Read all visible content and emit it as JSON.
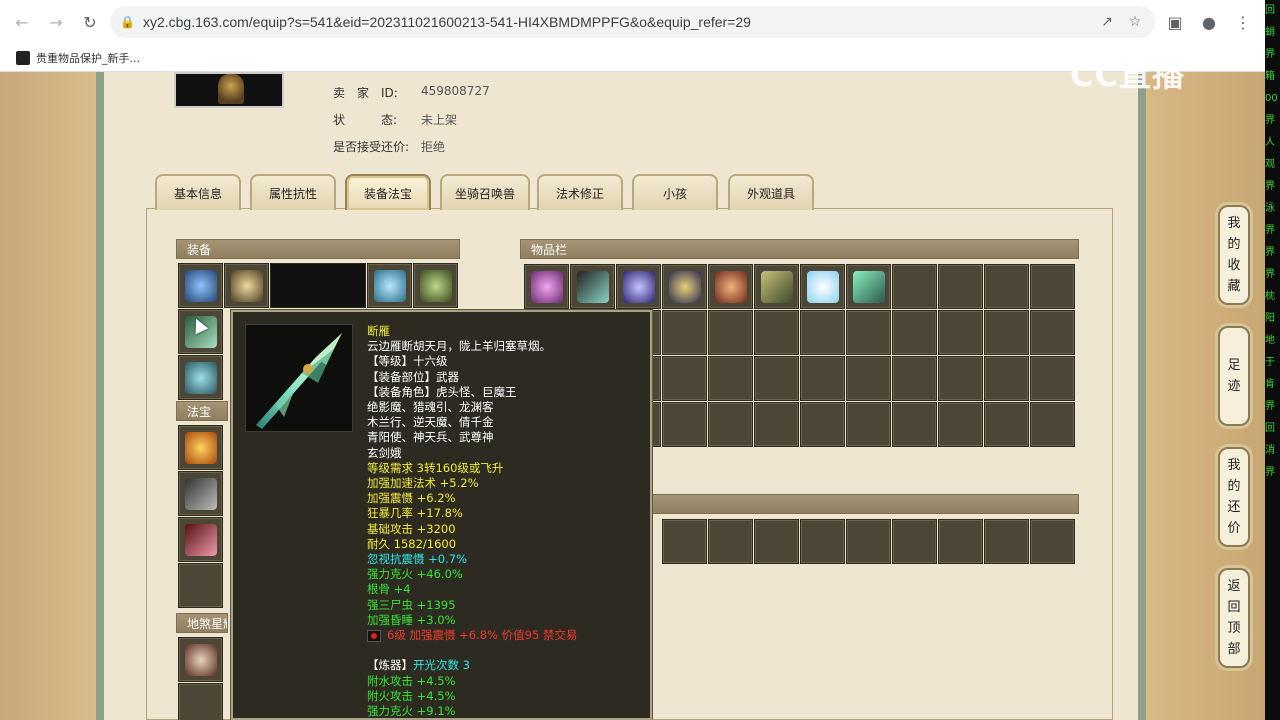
{
  "browser": {
    "url": "xy2.cbg.163.com/equip?s=541&eid=202311021600213-541-HI4XBMDMPPFG&o&equip_refer=29",
    "bookmark": "贵重物品保护_新手..."
  },
  "watermark": "CC直播",
  "seller": {
    "id_label": "卖　家　ID:",
    "id_value": "459808727",
    "status_label": "状　　　态:",
    "status_value": "未上架",
    "counter_label": "是否接受还价:",
    "counter_value": "拒绝"
  },
  "tabs": [
    "基本信息",
    "属性抗性",
    "装备法宝",
    "坐骑召唤兽",
    "法术修正",
    "小孩",
    "外观道具"
  ],
  "sections": {
    "equip": "装备",
    "fabao": "法宝",
    "dishaxing": "地煞星耀",
    "inventory": "物品栏"
  },
  "side_buttons": [
    [
      "我",
      "的",
      "收",
      "藏"
    ],
    [
      "足",
      "迹"
    ],
    [
      "我",
      "的",
      "还",
      "价"
    ],
    [
      "返",
      "回",
      "顶",
      "部"
    ]
  ],
  "tooltip": {
    "name": "断雁",
    "lines": [
      {
        "text": "断雁",
        "color": "y"
      },
      {
        "text": "云边雁断胡天月，陇上羊归塞草烟。",
        "color": "w"
      },
      {
        "text": "【等级】十六级",
        "color": "w"
      },
      {
        "text": "【装备部位】武器",
        "color": "w"
      },
      {
        "text": "【装备角色】虎头怪、巨魔王",
        "color": "w"
      },
      {
        "text": "绝影魔、猎魂引、龙渊客",
        "color": "w"
      },
      {
        "text": "木兰行、逆天魔、倩千金",
        "color": "w"
      },
      {
        "text": "青阳使、神天兵、武尊神",
        "color": "w"
      },
      {
        "text": "玄剑娥",
        "color": "w"
      },
      {
        "text": "等级需求 3转160级或飞升",
        "color": "y"
      },
      {
        "text": "加强加速法术 +5.2%",
        "color": "y"
      },
      {
        "text": "加强震慑 +6.2%",
        "color": "y"
      },
      {
        "text": "狂暴几率 +17.8%",
        "color": "y"
      },
      {
        "text": "基础攻击 +3200",
        "color": "y"
      },
      {
        "text": "耐久 1582/1600",
        "color": "y"
      },
      {
        "text": "忽视抗震慑 +0.7%",
        "color": "c"
      },
      {
        "text": "强力克火 +46.0%",
        "color": "g"
      },
      {
        "text": "根骨 +4",
        "color": "g"
      },
      {
        "text": "强三尸虫 +1395",
        "color": "g"
      },
      {
        "text": "加强昏睡 +3.0%",
        "color": "g"
      },
      {
        "text": "6级 加强震慑 +6.8% 价值95 禁交易",
        "color": "r",
        "gem": true
      },
      {
        "text": "",
        "color": "w"
      },
      {
        "text": "【炼器】开光次数 3",
        "color": "lianqi"
      },
      {
        "text": "附水攻击 +4.5%",
        "color": "g"
      },
      {
        "text": "附火攻击 +4.5%",
        "color": "g"
      },
      {
        "text": "强力克火 +9.1%",
        "color": "g"
      }
    ],
    "lianqi_label": "【炼器】",
    "lianqi_value": "开光次数 3"
  },
  "colors": {
    "y": "#f2ec3c",
    "w": "#ffffff",
    "g": "#36e536",
    "c": "#30e8e8",
    "r": "#ee3b2e"
  },
  "stream_strip": [
    "回",
    "蛸",
    "界",
    "箱",
    "00",
    "界",
    "人",
    "观",
    "界",
    "泳",
    "界",
    "界",
    "界",
    "枕",
    "阳",
    "地",
    "于",
    "肯",
    "界",
    "回",
    "消",
    "界"
  ]
}
